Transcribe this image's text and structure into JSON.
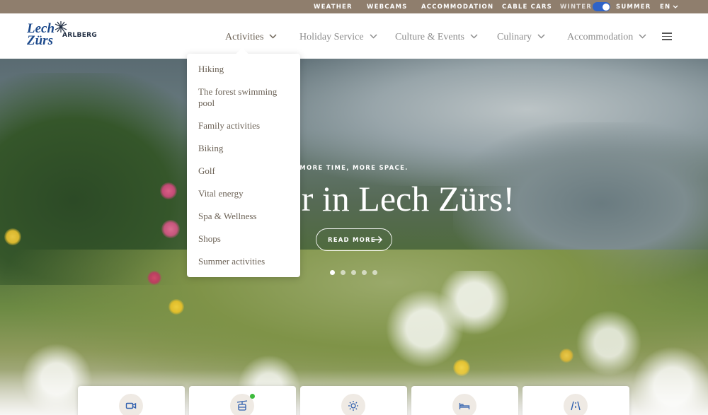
{
  "topbar": {
    "links": [
      "WEATHER",
      "WEBCAMS",
      "ACCOMMODATION",
      "CABLE CARS"
    ],
    "season_winter": "WINTER",
    "season_summer": "SUMMER",
    "season_selected": "SUMMER",
    "language": "EN"
  },
  "logo": {
    "line1": "Lech",
    "line2": "Zürs",
    "region": "ARLBERG"
  },
  "nav": {
    "items": [
      "Activities",
      "Holiday Service",
      "Culture & Events",
      "Culinary",
      "Accommodation"
    ],
    "active": "Activities"
  },
  "dropdown": {
    "items": [
      "Hiking",
      "The forest swimming pool",
      "Family activities",
      "Biking",
      "Golf",
      "Vital energy",
      "Spa & Wellness",
      "Shops",
      "Summer activities"
    ]
  },
  "hero": {
    "kicker": "MORE TIME, MORE SPACE.",
    "title": "Summer in Lech Zürs!",
    "cta": "READ MORE",
    "slide_count": 5,
    "active_slide": 1
  },
  "quick_links": {
    "icons": [
      "webcam-icon",
      "cable-car-icon",
      "sun-icon",
      "bed-icon",
      "road-icon"
    ]
  },
  "colors": {
    "topbar_bg": "#8f7e6d",
    "logo_blue": "#1d4a8c",
    "toggle_blue": "#2f63c7",
    "icon_blue": "#2f5fae",
    "live_green": "#3dbb3d"
  }
}
